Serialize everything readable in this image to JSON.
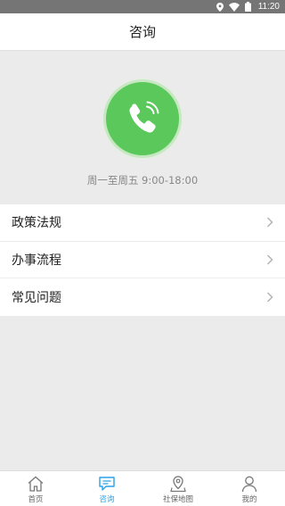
{
  "status_bar": {
    "time": "11:20",
    "icons": [
      "location-icon",
      "wifi-icon",
      "battery-icon"
    ]
  },
  "header": {
    "title": "咨询"
  },
  "hero": {
    "icon": "phone-call-icon",
    "icon_color": "#5ac85a",
    "service_hours": "周一至周五 9:00-18:00"
  },
  "menu": {
    "items": [
      {
        "label": "政策法规",
        "icon": "chevron-right-icon"
      },
      {
        "label": "办事流程",
        "icon": "chevron-right-icon"
      },
      {
        "label": "常见问题",
        "icon": "chevron-right-icon"
      }
    ]
  },
  "tab_bar": {
    "active_color": "#2aa0e8",
    "items": [
      {
        "label": "首页",
        "icon": "home-icon",
        "active": false
      },
      {
        "label": "咨询",
        "icon": "chat-icon",
        "active": true
      },
      {
        "label": "社保地图",
        "icon": "map-pin-icon",
        "active": false
      },
      {
        "label": "我的",
        "icon": "user-icon",
        "active": false
      }
    ]
  }
}
